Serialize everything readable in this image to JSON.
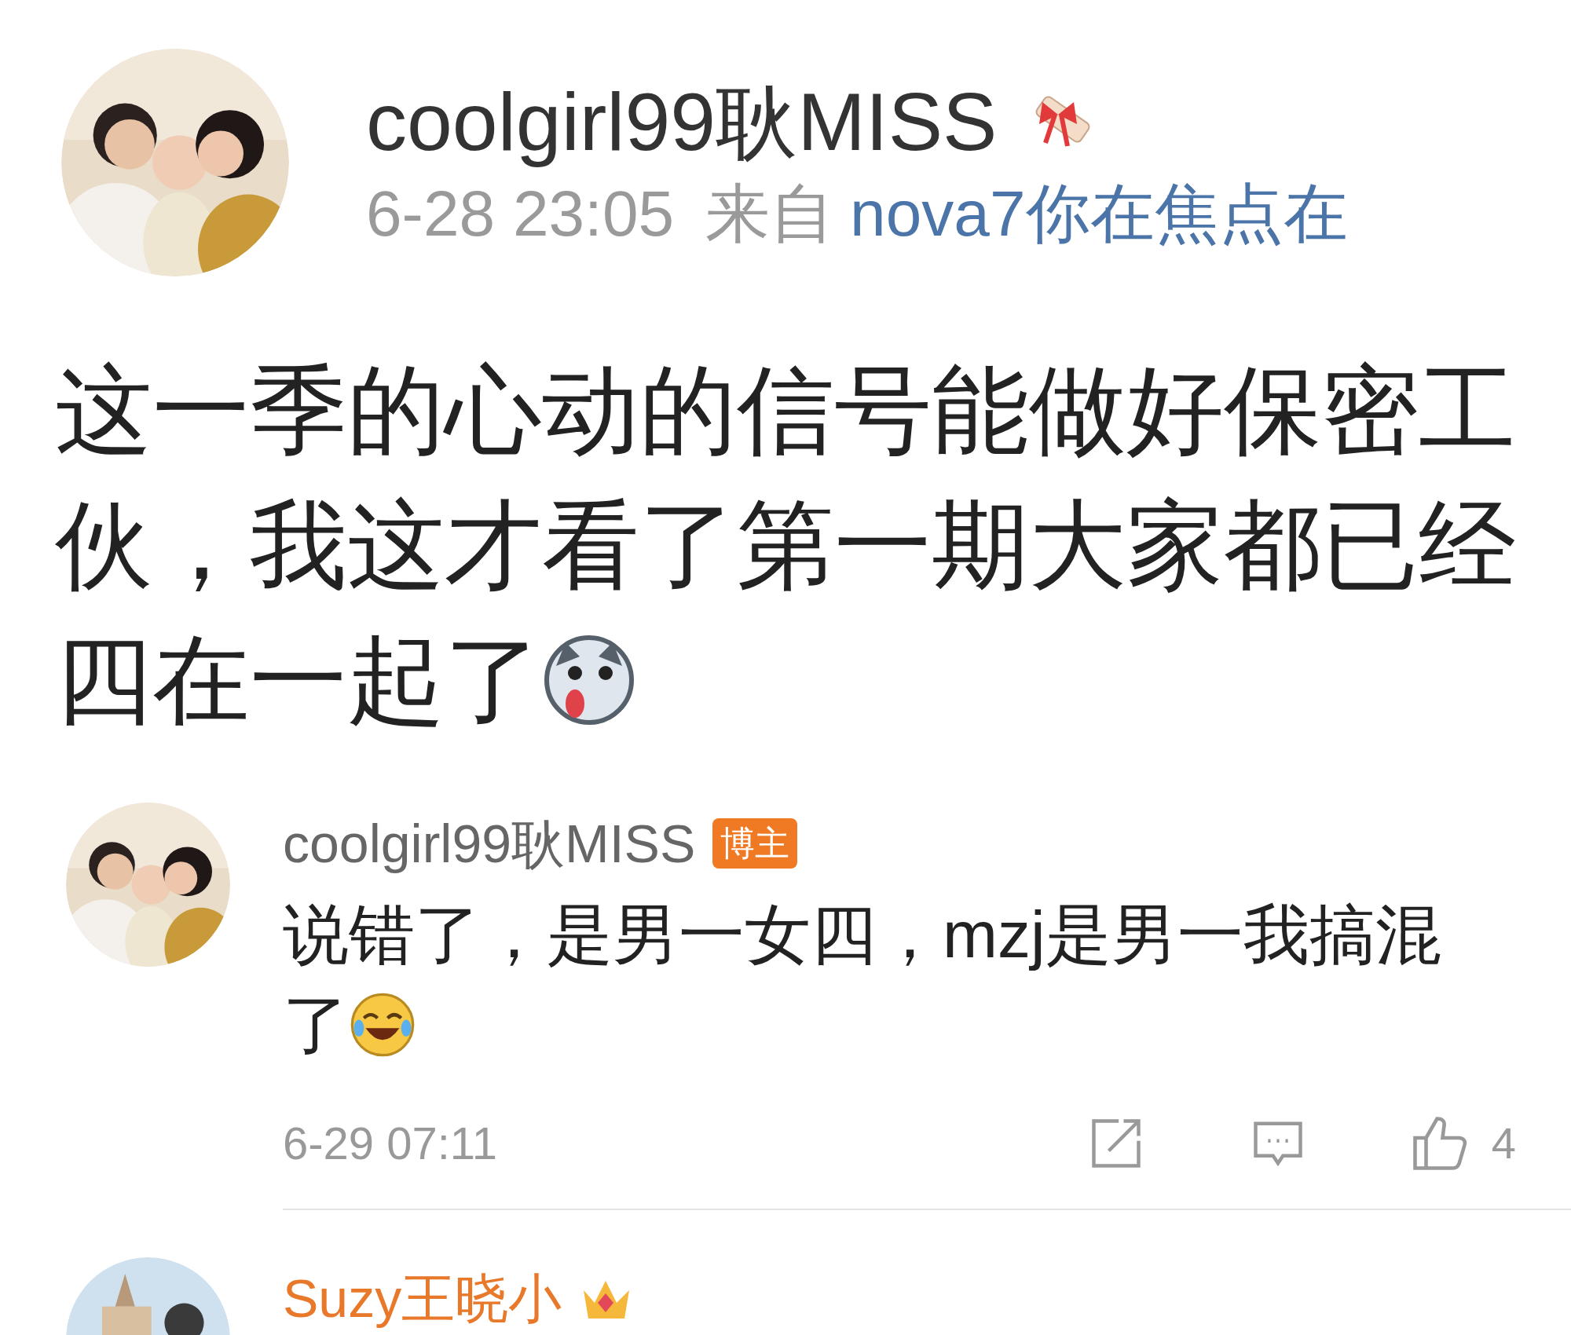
{
  "post": {
    "author": "coolgirl99耿MISS",
    "time": "6-28 23:05",
    "source_label": "来自",
    "source": "nova7你在焦点在",
    "lines": [
      {
        "kind": "plain",
        "text": "这一季的心动的信号能做好保密工"
      },
      {
        "kind": "plain",
        "text": "伙，我这才看了第一期大家都已经"
      },
      {
        "kind": "dog",
        "text": "四在一起了"
      }
    ]
  },
  "comments": [
    {
      "kind": "blogger",
      "author": "coolgirl99耿MISS",
      "badge": "博主",
      "lines": [
        {
          "kind": "plain",
          "text": "说错了，是男一女四，mzj是男一我搞混"
        },
        {
          "kind": "laugh",
          "text": "了"
        }
      ],
      "time": "6-29 07:11",
      "likes": "4"
    },
    {
      "kind": "vip",
      "author": "Suzy王晓小"
    }
  ]
}
